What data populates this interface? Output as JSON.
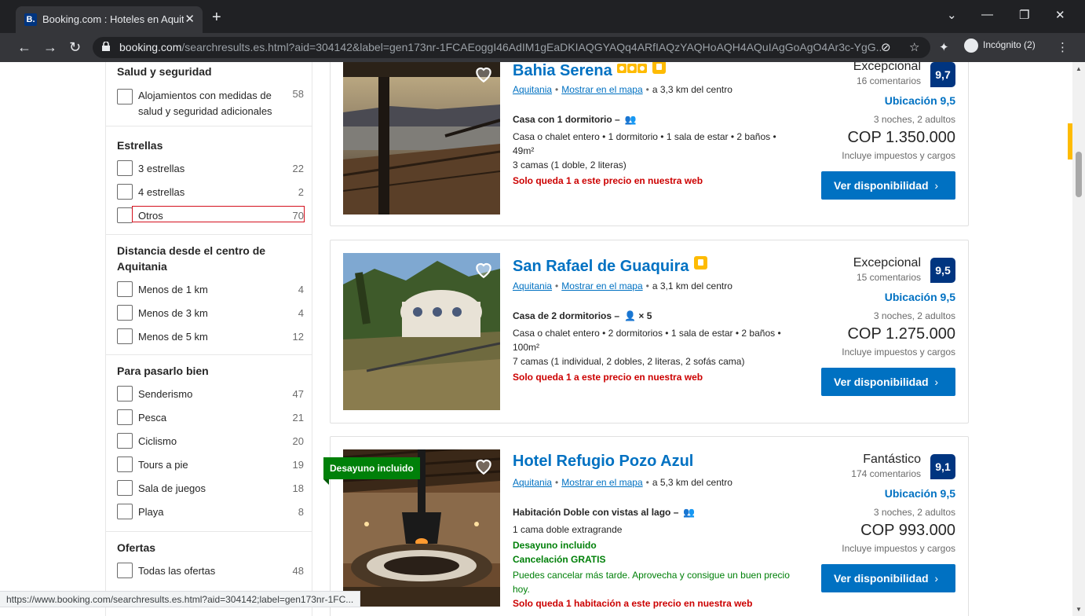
{
  "browser": {
    "tab_title": "Booking.com : Hoteles en Aquitania",
    "tab_favicon": "B.",
    "url_domain": "booking.com",
    "url_path": "/searchresults.es.html?aid=304142&label=gen173nr-1FCAEoggI46AdIM1gEaDKIAQGYAQq4ARfIAQzYAQHoAQH4AQuIAgGoAgO4Ar3c-YgG...",
    "profile": "Incógnito (2)",
    "status_url": "https://www.booking.com/searchresults.es.html?aid=304142;label=gen173nr-1FC..."
  },
  "filters": {
    "health": {
      "title": "Salud y seguridad",
      "options": [
        {
          "label": "Alojamientos con medidas de salud y seguridad adicionales",
          "count": "58"
        }
      ]
    },
    "stars": {
      "title": "Estrellas",
      "options": [
        {
          "label": "3 estrellas",
          "count": "22"
        },
        {
          "label": "4 estrellas",
          "count": "2"
        },
        {
          "label": "Otros",
          "count": "70"
        }
      ]
    },
    "distance": {
      "title": "Distancia desde el centro de Aquitania",
      "options": [
        {
          "label": "Menos de 1 km",
          "count": "4"
        },
        {
          "label": "Menos de 3 km",
          "count": "4"
        },
        {
          "label": "Menos de 5 km",
          "count": "12"
        }
      ]
    },
    "fun": {
      "title": "Para pasarlo bien",
      "options": [
        {
          "label": "Senderismo",
          "count": "47"
        },
        {
          "label": "Pesca",
          "count": "21"
        },
        {
          "label": "Ciclismo",
          "count": "20"
        },
        {
          "label": "Tours a pie",
          "count": "19"
        },
        {
          "label": "Sala de juegos",
          "count": "18"
        },
        {
          "label": "Playa",
          "count": "8"
        }
      ]
    },
    "deals": {
      "title": "Ofertas",
      "options": [
        {
          "label": "Todas las ofertas",
          "count": "48"
        }
      ]
    }
  },
  "results": [
    {
      "name": "Bahia Serena",
      "region": "Aquitania",
      "map_link": "Mostrar en el mapa",
      "distance": "a 3,3 km del centro",
      "room": "Casa con 1 dormitorio",
      "room_sep": "–",
      "desc1": "Casa o chalet entero • 1 dormitorio • 1 sala de estar • 2 baños • 49m²",
      "desc2": "3 camas (1 doble, 2 literas)",
      "scarcity": "Solo queda 1 a este precio en nuestra web",
      "review_word": "Excepcional",
      "review_count": "16 comentarios",
      "score": "9,7",
      "location_score": "Ubicación 9,5",
      "stay": "3 noches, 2 adultos",
      "price": "COP 1.350.000",
      "taxes": "Incluye impuestos y cargos",
      "cta": "Ver disponibilidad"
    },
    {
      "name": "San Rafael de Guaquira",
      "region": "Aquitania",
      "map_link": "Mostrar en el mapa",
      "distance": "a 3,1 km del centro",
      "room": "Casa de 2 dormitorios",
      "room_sep": "–",
      "guests": "× 5",
      "desc1": "Casa o chalet entero • 2 dormitorios • 1 sala de estar • 2 baños • 100m²",
      "desc2": "7 camas (1 individual, 2 dobles, 2 literas, 2 sofás cama)",
      "scarcity": "Solo queda 1 a este precio en nuestra web",
      "review_word": "Excepcional",
      "review_count": "15 comentarios",
      "score": "9,5",
      "location_score": "Ubicación 9,5",
      "stay": "3 noches, 2 adultos",
      "price": "COP 1.275.000",
      "taxes": "Incluye impuestos y cargos",
      "cta": "Ver disponibilidad"
    },
    {
      "name": "Hotel Refugio Pozo Azul",
      "ribbon": "Desayuno incluido",
      "region": "Aquitania",
      "map_link": "Mostrar en el mapa",
      "distance": "a 5,3 km del centro",
      "room": "Habitación Doble con vistas al lago",
      "room_sep": "–",
      "desc1": "1 cama doble extragrande",
      "breakfast": "Desayuno incluido",
      "cancel": "Cancelación GRATIS",
      "cancel_note": "Puedes cancelar más tarde. Aprovecha y consigue un buen precio hoy.",
      "scarcity": "Solo queda 1 habitación a este precio en nuestra web",
      "review_word": "Fantástico",
      "review_count": "174 comentarios",
      "score": "9,1",
      "location_score": "Ubicación 9,5",
      "stay": "3 noches, 2 adultos",
      "price": "COP 993.000",
      "taxes": "Incluye impuestos y cargos",
      "cta": "Ver disponibilidad"
    }
  ],
  "colors": {
    "brand": "#003580",
    "link": "#0071c2",
    "star": "#febb02",
    "alert": "#cc0000",
    "success": "#008009"
  }
}
